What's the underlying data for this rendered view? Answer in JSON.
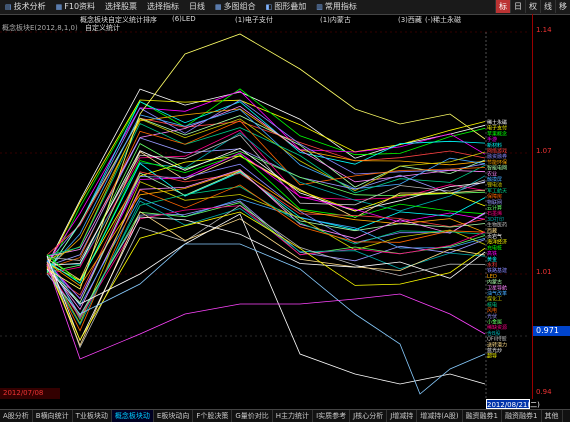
{
  "toolbar": {
    "buttons": [
      "技术分析",
      "F10资料",
      "选择股票",
      "选择指标",
      "日线",
      "多图组合",
      "图形叠加",
      "常用指标"
    ],
    "right": [
      "标",
      "日",
      "权",
      "线",
      "移"
    ]
  },
  "header": {
    "title": "概念板块自定义统计排序",
    "formula": "概念板块E(2012,8,1,0)",
    "subtitle": "自定义统计",
    "legend": [
      "(6)LED",
      "(1)电子支付",
      "(1)内蒙古",
      "(3)西藏",
      "(-)稀土永磁"
    ]
  },
  "axis": {
    "ticks": [
      "1.14",
      "1.07",
      "1.01",
      "0.94"
    ],
    "current": "0.971"
  },
  "dates": {
    "left": "2012/07/08",
    "right": "2012/08/21(二)"
  },
  "series_labels": [
    "稀土永磁",
    "电子支付",
    "苹果概念",
    "手游",
    "新材料",
    "网络游戏",
    "融资融券",
    "节能环保",
    "智能电网",
    "农业",
    "触摸屏",
    "锂电池",
    "军工航天",
    "保障房",
    "物联网",
    "云计算",
    "石墨烯",
    "3D打印",
    "生物医药",
    "西藏",
    "页岩气",
    "海洋经济",
    "充电桩",
    "高铁",
    "黄金",
    "水利",
    "铁路基建",
    "LED",
    "内蒙古",
    "卫星导航",
    "油气改革",
    "煤化工",
    "核电",
    "风电",
    "光伏",
    "小金属",
    "稀缺资源",
    "含B股",
    "QFII持股",
    "送转潜力",
    "蓝光炒",
    "超导"
  ],
  "tabs": [
    "A股分析",
    "B横向统计",
    "T业板块动",
    "概念板块动",
    "E板块动向",
    "F个股决策",
    "G量价对比",
    "H主力统计",
    "I实质参考",
    "J核心分析",
    "J增减持",
    "增减持(A股)",
    "融资融券1",
    "融资融券1",
    "其他"
  ],
  "active_tab": 3
}
